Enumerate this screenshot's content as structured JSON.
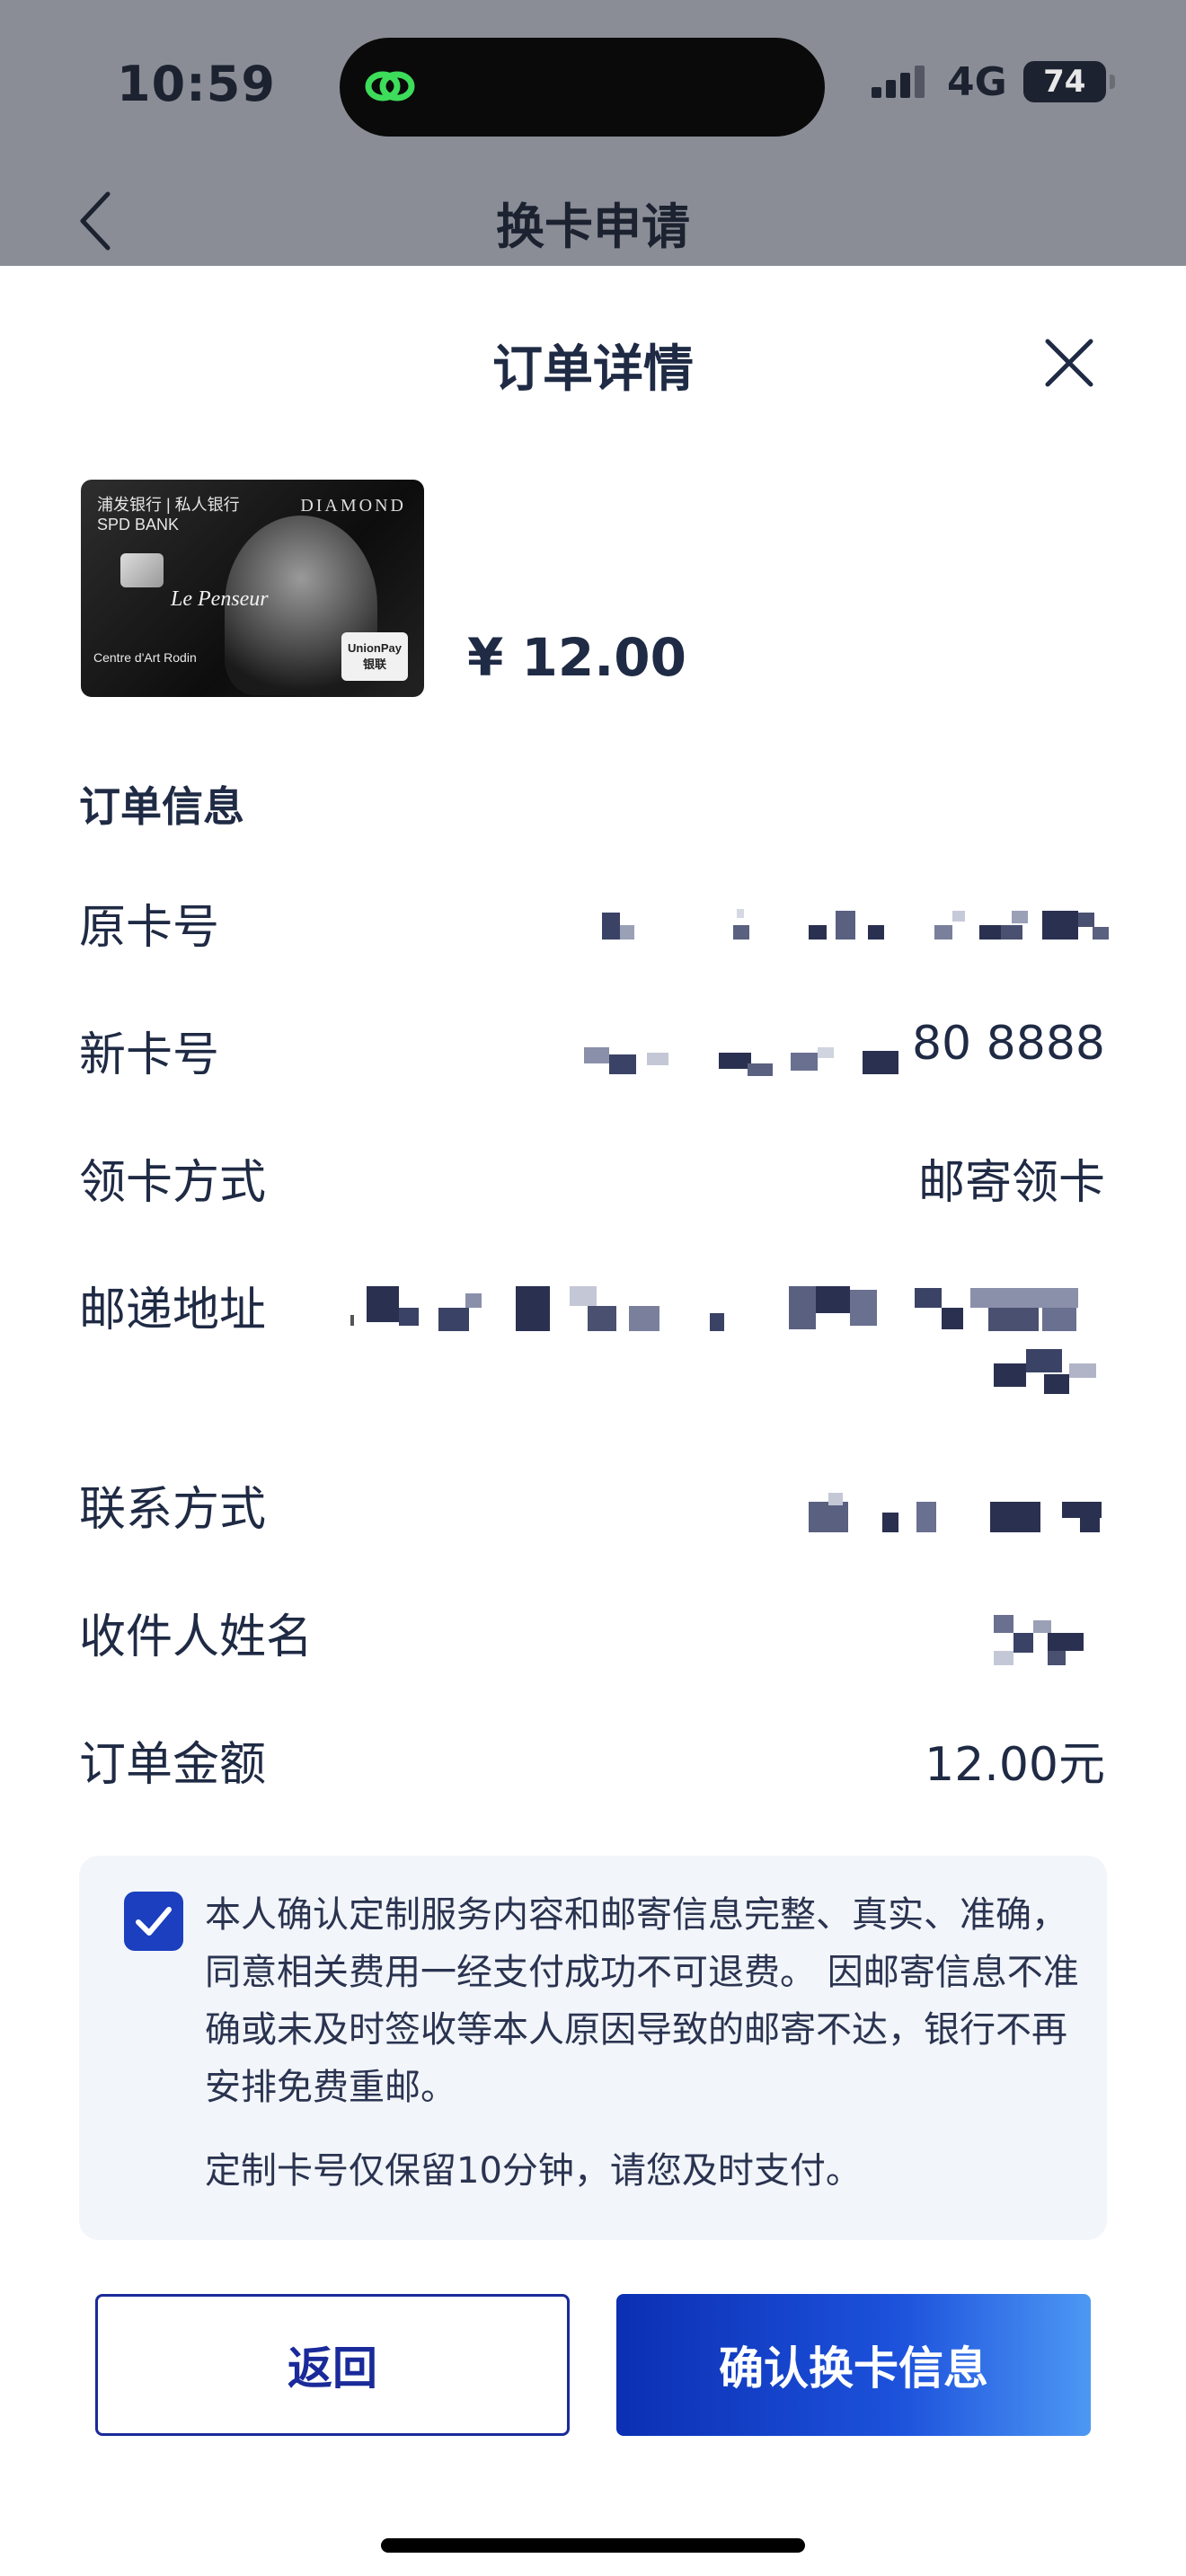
{
  "status_bar": {
    "time": "10:59",
    "network": "4G",
    "battery": "74"
  },
  "background_page": {
    "title": "换卡申请"
  },
  "sheet": {
    "title": "订单详情",
    "card": {
      "bank": "浦发银行 | 私人银行",
      "bank_en": "SPD BANK",
      "tier": "DIAMOND",
      "script": "Le Penseur",
      "museum": "Centre d'Art Rodin",
      "network": "UnionPay 银联"
    },
    "price": "¥ 12.00",
    "order_info": {
      "section_title": "订单信息",
      "rows": [
        {
          "label": "原卡号",
          "value": ""
        },
        {
          "label": "新卡号",
          "value": "80 8888"
        },
        {
          "label": "领卡方式",
          "value": "邮寄领卡"
        },
        {
          "label": "邮递地址",
          "value": ""
        },
        {
          "label": "联系方式",
          "value": ""
        },
        {
          "label": "收件人姓名",
          "value": ""
        },
        {
          "label": "订单金额",
          "value": "12.00元"
        }
      ]
    },
    "notice": {
      "checked": true,
      "text": "本人确认定制服务内容和邮寄信息完整、真实、准确，同意相关费用一经支付成功不可退费。 因邮寄信息不准确或未及时签收等本人原因导致的邮寄不达，银行不再安排免费重邮。",
      "sub": "定制卡号仅保留10分钟，请您及时支付。"
    },
    "buttons": {
      "back": "返回",
      "confirm": "确认换卡信息"
    }
  },
  "colors": {
    "primary": "#1a2a9a",
    "accent_gradient_end": "#4d98f4",
    "text": "#1f2a44",
    "notice_bg": "#f2f5f9"
  }
}
